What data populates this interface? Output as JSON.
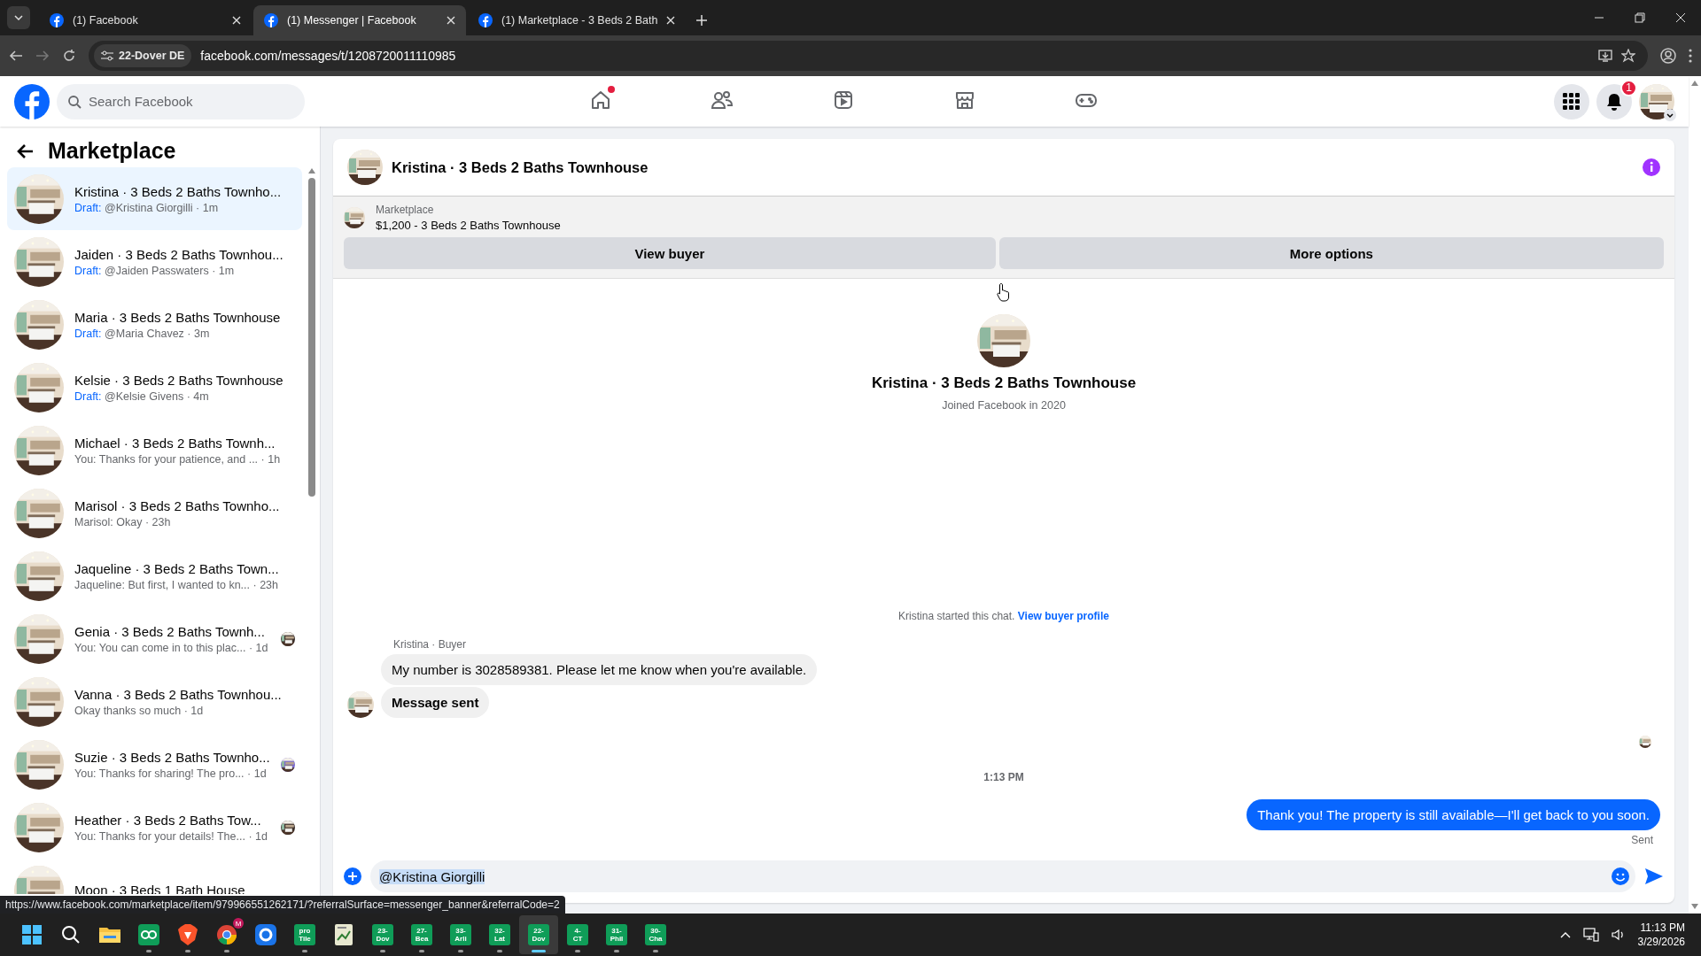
{
  "browser": {
    "tabs": [
      {
        "title": "(1) Facebook",
        "selected": false
      },
      {
        "title": "(1) Messenger | Facebook",
        "selected": true
      },
      {
        "title": "(1) Marketplace - 3 Beds 2 Bath",
        "selected": false
      }
    ],
    "site_chip": "22-Dover DE",
    "url": "facebook.com/messages/t/1208720011110985"
  },
  "facebook_nav": {
    "search": {
      "placeholder": "Search Facebook"
    },
    "nav_items": [
      {
        "kind": "home",
        "selected": false,
        "dot": true
      },
      {
        "kind": "friends",
        "selected": false,
        "dot": false
      },
      {
        "kind": "video",
        "selected": false,
        "dot": false
      },
      {
        "kind": "marketplace",
        "selected": false,
        "dot": false
      },
      {
        "kind": "gaming",
        "selected": false,
        "dot": false
      }
    ],
    "notification_count": "1"
  },
  "sidebar": {
    "title": "Marketplace",
    "conversations": [
      {
        "title": "Kristina · 3 Beds 2 Baths Townho...",
        "prefix": "Draft:",
        "preview": "@Kristina Giorgilli",
        "time": "· 1m",
        "selected": true,
        "seen": false
      },
      {
        "title": "Jaiden · 3 Beds 2 Baths Townhou...",
        "prefix": "Draft:",
        "preview": "@Jaiden Passwaters",
        "time": "· 1m",
        "selected": false,
        "seen": false
      },
      {
        "title": "Maria · 3 Beds 2 Baths Townhouse",
        "prefix": "Draft:",
        "preview": "@Maria Chavez",
        "time": "· 3m",
        "selected": false,
        "seen": false
      },
      {
        "title": "Kelsie · 3 Beds 2 Baths Townhouse",
        "prefix": "Draft:",
        "preview": "@Kelsie Givens",
        "time": "· 4m",
        "selected": false,
        "seen": false
      },
      {
        "title": "Michael · 3 Beds 2 Baths Townh...",
        "preview": "You: Thanks for your patience, and ...",
        "time": "· 1h",
        "selected": false,
        "seen": false
      },
      {
        "title": "Marisol · 3 Beds 2 Baths Townho...",
        "preview": "Marisol: Okay",
        "time": "· 23h",
        "selected": false,
        "seen": false
      },
      {
        "title": "Jaqueline · 3 Beds 2 Baths Town...",
        "preview": "Jaqueline: But first, I wanted to kn...",
        "time": "· 23h",
        "selected": false,
        "seen": false
      },
      {
        "title": "Genia · 3 Beds 2 Baths Townh...",
        "preview": "You: You can come in to this plac...",
        "time": "· 1d",
        "selected": false,
        "seen": true
      },
      {
        "title": "Vanna · 3 Beds 2 Baths Townhou...",
        "preview": "Okay thanks so much",
        "time": "· 1d",
        "selected": false,
        "seen": false
      },
      {
        "title": "Suzie · 3 Beds 2 Baths Townho...",
        "preview": "You: Thanks for sharing! The pro...",
        "time": "· 1d",
        "selected": false,
        "seen": true
      },
      {
        "title": "Heather · 3 Beds 2 Baths Tow...",
        "preview": "You: Thanks for your details! The...",
        "time": "· 1d",
        "selected": false,
        "seen": true
      },
      {
        "title": "Moon · 3 Beds 1 Bath House",
        "selected": false,
        "seen": false
      }
    ]
  },
  "chat": {
    "title": "Kristina · 3 Beds 2 Baths Townhouse",
    "listing": {
      "label": "Marketplace",
      "summary": "$1,200 - 3 Beds 2 Baths Townhouse",
      "buttons": [
        "View buyer",
        "More options"
      ]
    },
    "profile": {
      "name": "Kristina · 3 Beds 2 Baths Townhouse",
      "joined": "Joined Facebook in 2020"
    },
    "start_note": {
      "text": "Kristina started this chat.",
      "link": "View buyer profile"
    },
    "messages": [
      {
        "kind": "sender_label",
        "text": "Kristina · Buyer"
      },
      {
        "kind": "incoming",
        "text": "My number is 3028589381. Please let me know when you're available.",
        "bold": false,
        "avatar": false
      },
      {
        "kind": "incoming",
        "text": "Message sent",
        "bold": true,
        "avatar": true
      },
      {
        "kind": "read_receipt"
      },
      {
        "kind": "timestamp",
        "text": "1:13 PM"
      },
      {
        "kind": "outgoing",
        "text": "Thank you! The property is still available—I'll get back to you soon.",
        "status": "Sent"
      }
    ],
    "composer": {
      "value": "@Kristina Giorgilli"
    }
  },
  "status_url": "https://www.facebook.com/marketplace/item/979966551262171/?referralSurface=messenger_banner&referralCode=2",
  "taskbar": {
    "items": [
      {
        "kind": "start",
        "running": false,
        "selected": false
      },
      {
        "kind": "search",
        "running": false,
        "selected": false
      },
      {
        "kind": "explorer",
        "running": false,
        "selected": false
      },
      {
        "kind": "loop",
        "running": true,
        "selected": false
      },
      {
        "kind": "lion",
        "running": true,
        "selected": false
      },
      {
        "kind": "chrome",
        "badge": "M",
        "running": true,
        "selected": false
      },
      {
        "kind": "ring",
        "running": false,
        "selected": false
      },
      {
        "kind": "tile",
        "lines": [
          "pro",
          "Tile"
        ],
        "running": true,
        "selected": false
      },
      {
        "kind": "sheet",
        "running": false,
        "selected": false
      },
      {
        "kind": "tile",
        "lines": [
          "23-",
          "Dov"
        ],
        "running": true,
        "selected": false
      },
      {
        "kind": "tile",
        "lines": [
          "27-",
          "Bea"
        ],
        "running": true,
        "selected": false
      },
      {
        "kind": "tile",
        "lines": [
          "33-",
          "Arli"
        ],
        "running": true,
        "selected": false
      },
      {
        "kind": "tile",
        "lines": [
          "32-",
          "Lat"
        ],
        "running": true,
        "selected": false
      },
      {
        "kind": "tile",
        "lines": [
          "22-",
          "Dov"
        ],
        "running": true,
        "selected": true
      },
      {
        "kind": "tile",
        "lines": [
          "4-",
          "CT"
        ],
        "running": true,
        "selected": false
      },
      {
        "kind": "tile",
        "lines": [
          "31-",
          "Phil"
        ],
        "running": true,
        "selected": false
      },
      {
        "kind": "tile",
        "lines": [
          "30-",
          "Cha"
        ],
        "running": true,
        "selected": false
      }
    ],
    "time": "11:13 PM",
    "date": "3/29/2026"
  }
}
